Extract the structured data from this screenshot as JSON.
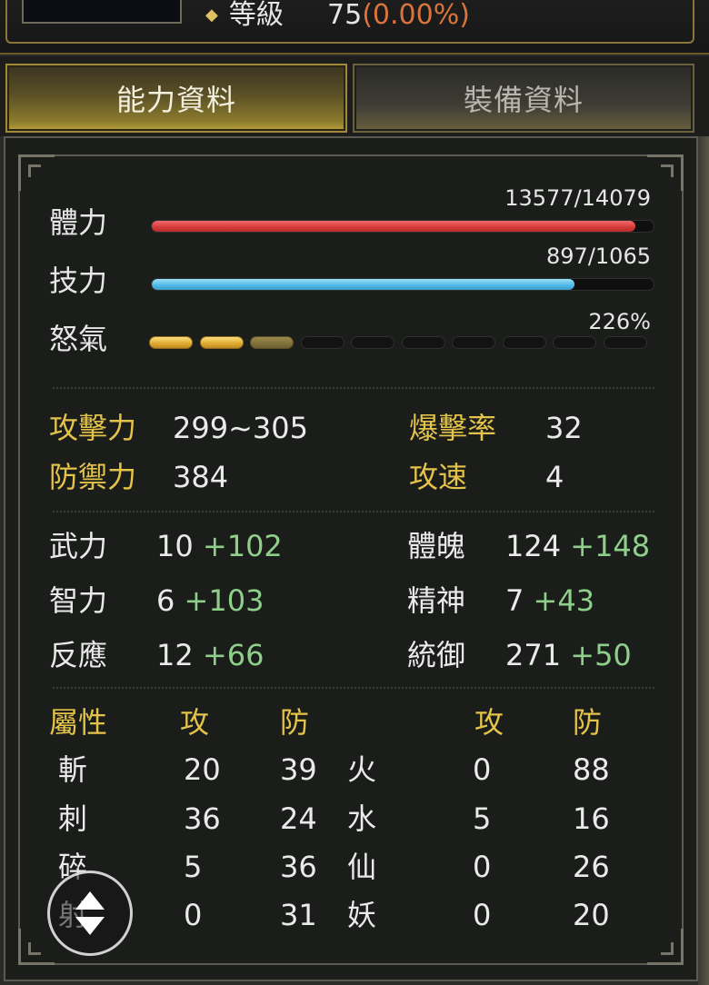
{
  "header": {
    "level_label": "等級",
    "level_value": "75",
    "level_percent": "(0.00%)"
  },
  "tabs": [
    {
      "label": "能力資料",
      "active": true
    },
    {
      "label": "裝備資料",
      "active": false
    }
  ],
  "vitals": {
    "hp": {
      "label": "體力",
      "text": "13577/14079",
      "current": 13577,
      "max": 14079
    },
    "mp": {
      "label": "技力",
      "text": "897/1065",
      "current": 897,
      "max": 1065
    },
    "rage": {
      "label": "怒氣",
      "text": "226%",
      "segments_total": 10,
      "segments_full": 2,
      "segment_partial": 1
    }
  },
  "combat": {
    "attack": {
      "label": "攻擊力",
      "value": "299~305"
    },
    "defense": {
      "label": "防禦力",
      "value": "384"
    },
    "crit": {
      "label": "爆擊率",
      "value": "32"
    },
    "speed": {
      "label": "攻速",
      "value": "4"
    }
  },
  "attributes": {
    "str": {
      "label": "武力",
      "base": "10",
      "bonus": "+102"
    },
    "int": {
      "label": "智力",
      "base": "6",
      "bonus": "+103"
    },
    "agi": {
      "label": "反應",
      "base": "12",
      "bonus": "+66"
    },
    "con": {
      "label": "體魄",
      "base": "124",
      "bonus": "+148"
    },
    "spi": {
      "label": "精神",
      "base": "7",
      "bonus": "+43"
    },
    "lead": {
      "label": "統御",
      "base": "271",
      "bonus": "+50"
    }
  },
  "elements": {
    "header": {
      "property": "屬性",
      "attack": "攻",
      "defense": "防",
      "attack2": "攻",
      "defense2": "防"
    },
    "left": [
      {
        "name": "斬",
        "atk": "20",
        "def": "39"
      },
      {
        "name": "刺",
        "atk": "36",
        "def": "24"
      },
      {
        "name": "碎",
        "atk": "5",
        "def": "36"
      },
      {
        "name": "射",
        "atk": "0",
        "def": "31"
      }
    ],
    "right": [
      {
        "name": "火",
        "atk": "0",
        "def": "88"
      },
      {
        "name": "水",
        "atk": "5",
        "def": "16"
      },
      {
        "name": "仙",
        "atk": "0",
        "def": "26"
      },
      {
        "name": "妖",
        "atk": "0",
        "def": "20"
      }
    ]
  },
  "colors": {
    "gold_label": "#e3c34a",
    "bonus_green": "#8ed08a",
    "hp_red": "#d63a3a",
    "mp_blue": "#4fb8e8",
    "rage_gold": "#e0a830",
    "level_percent_orange": "#d9743c"
  },
  "icons": {
    "level_bullet": "diamond-bullet-icon",
    "scroll": "up-down-arrows-icon"
  }
}
